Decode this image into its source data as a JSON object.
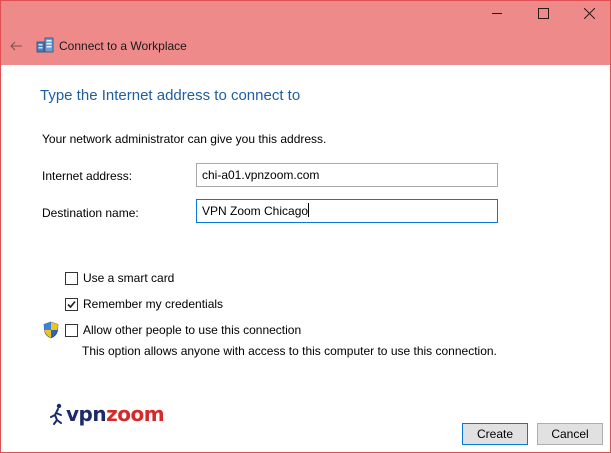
{
  "window": {
    "title": "Connect to a Workplace",
    "controls": [
      "minimize-icon",
      "maximize-icon",
      "close-icon"
    ],
    "titlebar_color": "#ee8a8a"
  },
  "page": {
    "heading": "Type the Internet address to connect to",
    "note": "Your network administrator can give you this address."
  },
  "form": {
    "internet_address_label": "Internet address:",
    "internet_address_value": "chi-a01.vpnzoom.com",
    "destination_name_label": "Destination name:",
    "destination_name_value": "VPN Zoom Chicago"
  },
  "options": {
    "smart_card_label": "Use a smart card",
    "smart_card_checked": false,
    "remember_label": "Remember my credentials",
    "remember_checked": true,
    "allow_others_label": "Allow other people to use this connection",
    "allow_others_checked": false,
    "allow_others_description": "This option allows anyone with access to this computer to use this connection."
  },
  "branding": {
    "logo_text_a": "vpn",
    "logo_text_b": "zoom"
  },
  "buttons": {
    "create": "Create",
    "cancel": "Cancel"
  },
  "colors": {
    "accent": "#0a78d7",
    "heading": "#1e5fa0",
    "logo_blue": "#1b2a6b",
    "logo_red": "#d62a2a"
  }
}
